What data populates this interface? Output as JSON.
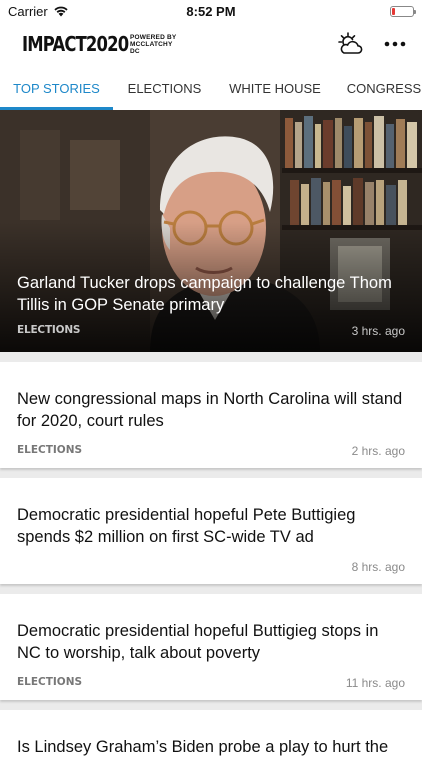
{
  "status_bar": {
    "carrier": "Carrier",
    "time": "8:52 PM"
  },
  "header": {
    "logo_text": "IMPACT2020",
    "logo_sub": "POWERED BY MCCLATCHY DC",
    "weather_icon": "weather-partly-cloudy-icon",
    "more_icon": "more-horizontal-icon"
  },
  "tabs": [
    {
      "label": "TOP STORIES",
      "active": true
    },
    {
      "label": "ELECTIONS",
      "active": false
    },
    {
      "label": "WHITE HOUSE",
      "active": false
    },
    {
      "label": "CONGRESS",
      "active": false
    }
  ],
  "hero": {
    "title": "Garland Tucker drops campaign to challenge Thom Tillis in GOP Senate primary",
    "category": "ELECTIONS",
    "time": "3 hrs. ago"
  },
  "articles": [
    {
      "title": "New congressional maps in North Carolina will stand for 2020, court rules",
      "category": "ELECTIONS",
      "time": "2 hrs. ago"
    },
    {
      "title": "Democratic presidential hopeful Pete Buttigieg spends $2 million on first SC-wide TV ad",
      "category": "",
      "time": "8 hrs. ago"
    },
    {
      "title": "Democratic presidential hopeful Buttigieg stops in NC to worship, talk about poverty",
      "category": "ELECTIONS",
      "time": "11 hrs. ago"
    },
    {
      "title": "Is Lindsey Graham’s Biden probe a play to hurt the",
      "category": "",
      "time": ""
    }
  ],
  "colors": {
    "accent": "#1e88c9",
    "battery_low": "#e53935"
  }
}
